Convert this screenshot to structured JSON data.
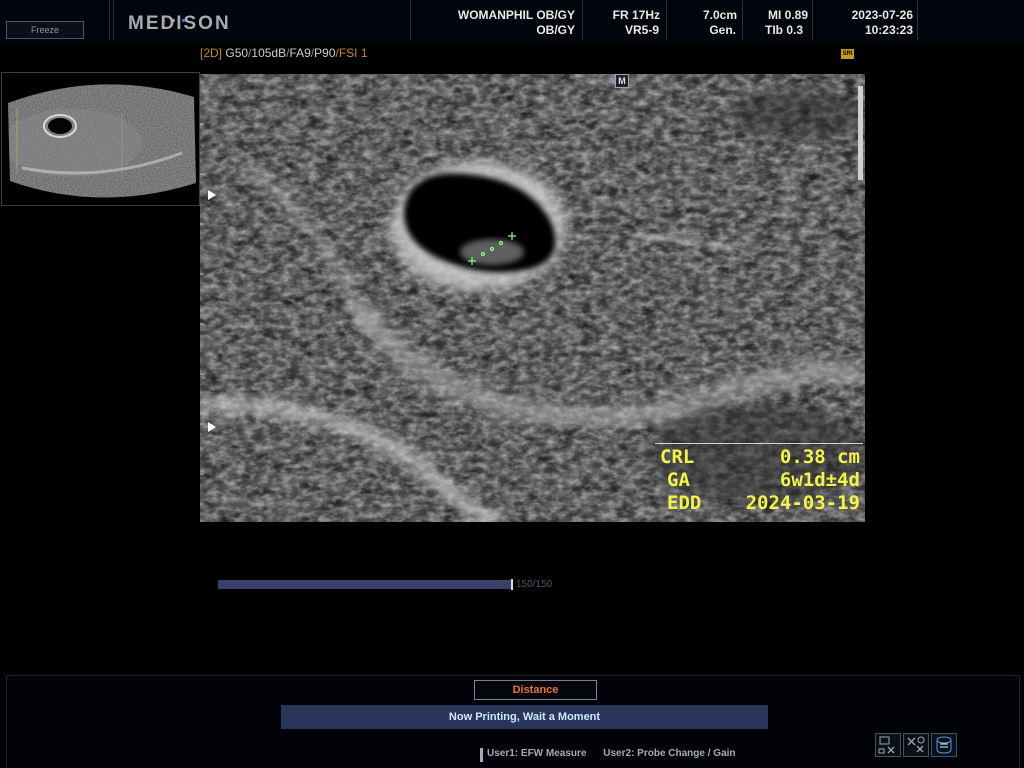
{
  "header": {
    "freeze_label": "Freeze",
    "brand": "MEDISON",
    "brand_dot_colors": [
      "#e03a2f",
      "#e0a02f",
      "#2f8be0"
    ],
    "institution": "WOMANPHIL OB/GY",
    "department": "OB/GY",
    "frame_rate": "FR 17Hz",
    "preset": "VR5-9",
    "depth": "7.0cm",
    "mode": "Gen.",
    "mi": "MI 0.89",
    "tib": "TIb 0.3",
    "date": "2023-07-26",
    "time": "10:23:23"
  },
  "params": {
    "mode": "[2D]",
    "gain": "G50",
    "dynamic_range": "105dB",
    "fa": "FA9",
    "power": "P90",
    "fsi": "FSI 1",
    "sri_badge": "SRI"
  },
  "image": {
    "marker_label": "M"
  },
  "measurement": {
    "crl_label": "CRL",
    "crl_value": "0.38 cm",
    "ga_label": "GA",
    "ga_value": "6w1d±4d",
    "edd_label": "EDD",
    "edd_value": "2024-03-19",
    "text_color": "#f3f34a"
  },
  "cine": {
    "label": "150/150",
    "progress": 1.0
  },
  "bottom": {
    "distance_label": "Distance",
    "status_message": "Now Printing, Wait a Moment",
    "user1": "User1: EFW Measure",
    "user2": "User2: Probe Change / Gain",
    "tool_icons": [
      "clear-measure-icon",
      "clear-all-icon",
      "print-icon"
    ]
  }
}
